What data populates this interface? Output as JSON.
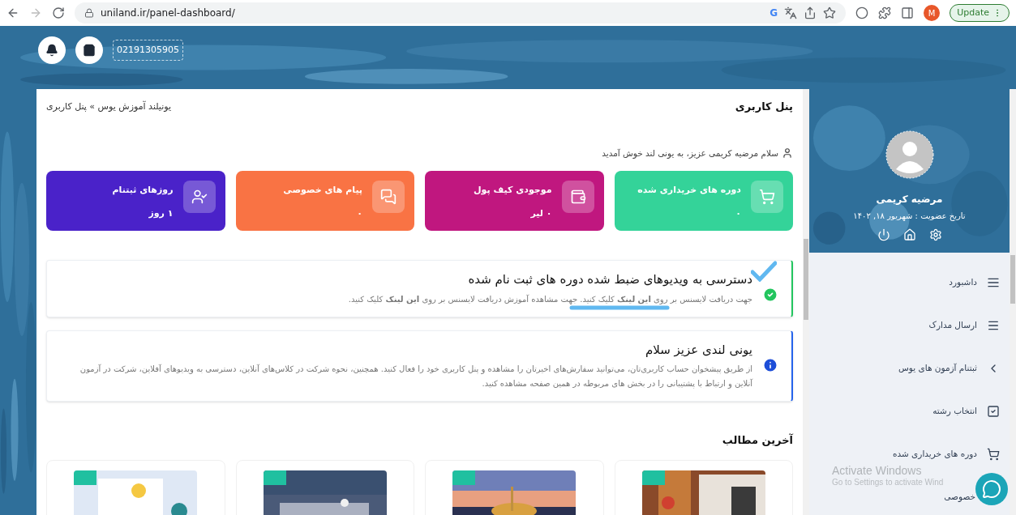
{
  "browser": {
    "url": "uniland.ir/panel-dashboard/",
    "avatar_letter": "M",
    "search_letter": "G",
    "update_label": "Update"
  },
  "header": {
    "phone": "02191305905"
  },
  "page": {
    "title": "پنل کاربری",
    "breadcrumb": "یونیلند آموزش یوس » پنل کاربری",
    "welcome": "سلام مرضیه کریمی عزیز، به یونی لند خوش آمدید"
  },
  "stats": [
    {
      "title": "دوره های خریداری شده",
      "value": "۰",
      "color": "#34d399"
    },
    {
      "title": "موجودی کیف پول",
      "value": "۰ لیر",
      "color": "#c0177f"
    },
    {
      "title": "پیام های خصوصی",
      "value": "۰",
      "color": "#f97344"
    },
    {
      "title": "روزهای ثبتنام",
      "value": "۱ روز",
      "color": "#4a22c9"
    }
  ],
  "notices": [
    {
      "kind": "success",
      "title": "دسترسی به ویدیوهای ضبط شده دوره های ثبت نام شده",
      "text": "جهت دریافت لایسنس بر روی **این لینک** کلیک کنید. جهت مشاهده آموزش دریافت لایسنس  بر روی **این لینک** کلیک کنید."
    },
    {
      "kind": "info",
      "title": "یونی لندی عزیز سلام",
      "text": "از طریق پیشخوان حساب کاربری‌تان، می‌توانید سفارش‌های اخیرتان را مشاهده و پنل کاربری خود را فعال کنید. همچنین، نحوه شرکت در کلاس‌های آنلاین، دسترسی به ویدیوهای آفلاین، شرکت در آزمون آنلاین و ارتباط با پشتیبانی را در بخش های مربوطه در همین صفحه مشاهده کنید."
    }
  ],
  "articles": {
    "title": "آخرین مطالب"
  },
  "profile": {
    "name": "مرضیه کریمی",
    "member_since": "تاریخ عضویت : شهریور ۱۸, ۱۴۰۲"
  },
  "menu": [
    {
      "label": "داشبورد"
    },
    {
      "label": "ارسال مدارک"
    },
    {
      "label": "ثبتنام آزمون های یوس"
    },
    {
      "label": "انتخاب رشته"
    },
    {
      "label": "دوره های خریداری شده"
    },
    {
      "label": "خصوصی"
    }
  ],
  "os_notice": {
    "title": "Activate Windows",
    "text": "Go to Settings to activate Wind"
  }
}
